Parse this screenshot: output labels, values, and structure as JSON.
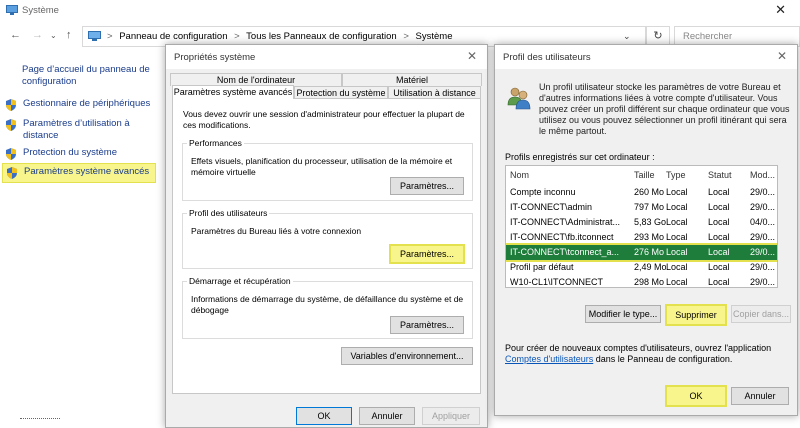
{
  "window": {
    "title": "Système",
    "close_glyph": "✕"
  },
  "address": {
    "breadcrumbs": [
      "Panneau de configuration",
      "Tous les Panneaux de configuration",
      "Système"
    ],
    "separator": ">",
    "search_placeholder": "Rechercher"
  },
  "left_pane": {
    "home_link": "Page d’accueil du panneau de configuration",
    "items": [
      {
        "label": "Gestionnaire de périphériques"
      },
      {
        "label": "Paramètres d’utilisation à distance"
      },
      {
        "label": "Protection du système"
      },
      {
        "label": "Paramètres système avancés"
      }
    ]
  },
  "sys_props": {
    "title": "Propriétés système",
    "tabs_top": [
      "Nom de l'ordinateur",
      "Matériel"
    ],
    "tabs_bottom": [
      "Paramètres système avancés",
      "Protection du système",
      "Utilisation à distance"
    ],
    "intro": "Vous devez ouvrir une session d'administrateur pour effectuer la plupart de ces modifications.",
    "groups": [
      {
        "label": "Performances",
        "desc": "Effets visuels, planification du processeur, utilisation de la mémoire et mémoire virtuelle",
        "button": "Paramètres..."
      },
      {
        "label": "Profil des utilisateurs",
        "desc": "Paramètres du Bureau liés à votre connexion",
        "button": "Paramètres..."
      },
      {
        "label": "Démarrage et récupération",
        "desc": "Informations de démarrage du système, de défaillance du système et de débogage",
        "button": "Paramètres..."
      }
    ],
    "env_button": "Variables d'environnement...",
    "ok": "OK",
    "cancel": "Annuler",
    "apply": "Appliquer"
  },
  "user_profiles": {
    "title": "Profil des utilisateurs",
    "intro": "Un profil utilisateur stocke les paramètres de votre Bureau et d'autres informations liées à votre compte d'utilisateur. Vous pouvez créer un profil différent sur chaque ordinateur que vous utilisez ou vous pouvez sélectionner un profil itinérant qui sera le même partout.",
    "list_label": "Profils enregistrés sur cet ordinateur :",
    "columns": [
      "Nom",
      "Taille",
      "Type",
      "Statut",
      "Mod..."
    ],
    "rows": [
      [
        "Compte inconnu",
        "260 Mo",
        "Local",
        "Local",
        "29/0..."
      ],
      [
        "IT-CONNECT\\admin",
        "797 Mo",
        "Local",
        "Local",
        "29/0..."
      ],
      [
        "IT-CONNECT\\Administrat...",
        "5,83 Go",
        "Local",
        "Local",
        "04/0..."
      ],
      [
        "IT-CONNECT\\fb.itconnect",
        "293 Mo",
        "Local",
        "Local",
        "29/0..."
      ],
      [
        "IT-CONNECT\\tconnect_a...",
        "276 Mo",
        "Local",
        "Local",
        "29/0..."
      ],
      [
        "Profil par défaut",
        "2,49 Mo",
        "Local",
        "Local",
        "29/0..."
      ],
      [
        "W10-CL1\\ITCONNECT",
        "298 Mo",
        "Local",
        "Local",
        "29/0..."
      ]
    ],
    "selected_row": 4,
    "btn_modify": "Modifier le type...",
    "btn_delete": "Supprimer",
    "btn_copy": "Copier dans...",
    "footer_pre": "Pour créer de nouveaux comptes d'utilisateurs, ouvrez l'application",
    "footer_link": "Comptes d'utilisateurs",
    "footer_post": "dans le Panneau de configuration.",
    "ok": "OK",
    "cancel": "Annuler"
  },
  "colors": {
    "link": "#1a3c8c",
    "highlight": "#f8f58c",
    "selection": "#1e7d3a"
  }
}
